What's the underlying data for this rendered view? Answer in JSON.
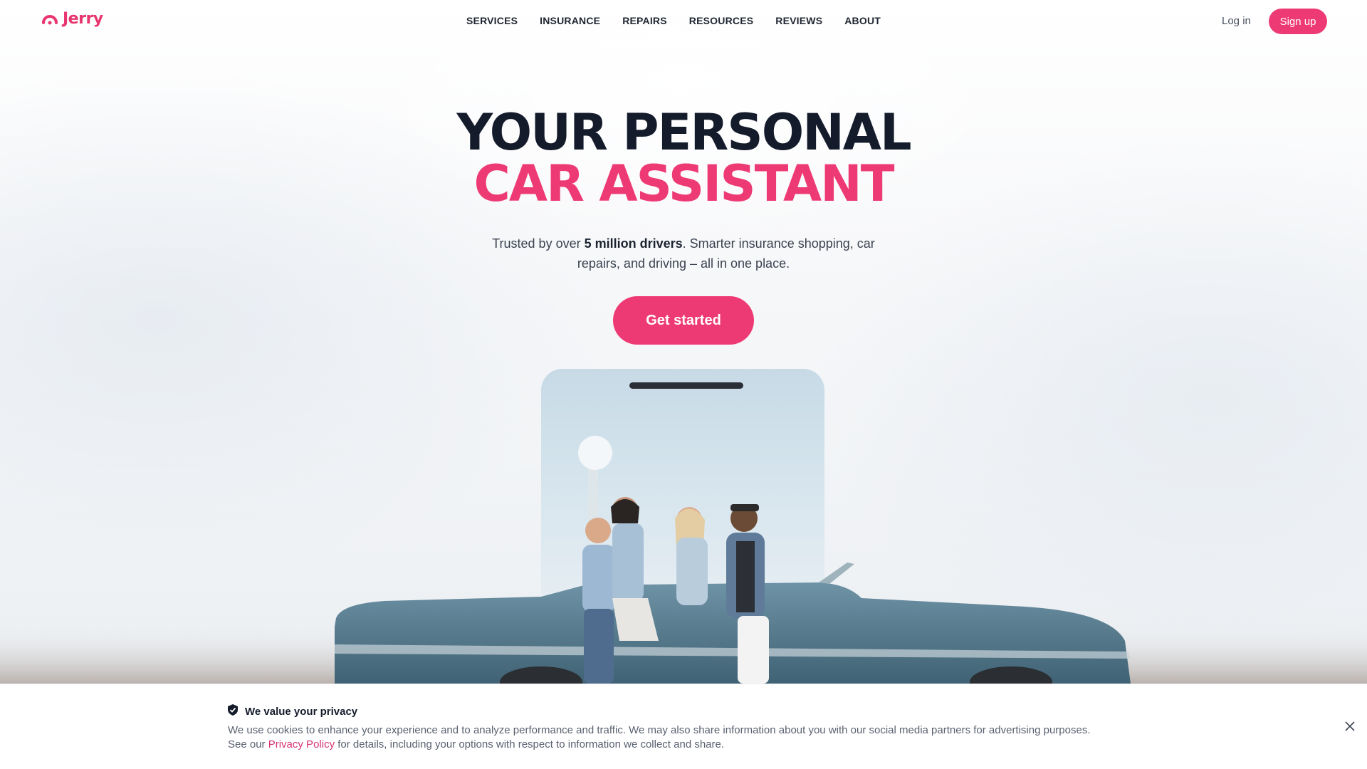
{
  "brand": {
    "name": "Jerry",
    "accent": "#ee3a74"
  },
  "nav": {
    "items": [
      {
        "label": "SERVICES"
      },
      {
        "label": "INSURANCE"
      },
      {
        "label": "REPAIRS"
      },
      {
        "label": "RESOURCES"
      },
      {
        "label": "REVIEWS"
      },
      {
        "label": "ABOUT"
      }
    ],
    "login": "Log in",
    "signup": "Sign up"
  },
  "hero": {
    "title_line1": "YOUR PERSONAL",
    "title_line2": "CAR ASSISTANT",
    "sub_prefix": "Trusted by over ",
    "sub_bold": "5 million drivers",
    "sub_suffix": ". Smarter insurance shopping, car repairs, and driving – all in one place.",
    "cta": "Get started"
  },
  "cookie": {
    "title": "We value your privacy",
    "text_line1": "We use cookies to enhance your experience and to analyze performance and traffic. We may also share information about you with our social media partners for advertising purposes.",
    "text_see": "See our ",
    "link": "Privacy Policy",
    "text_after": " for details, including your options with respect to information we collect and share."
  }
}
